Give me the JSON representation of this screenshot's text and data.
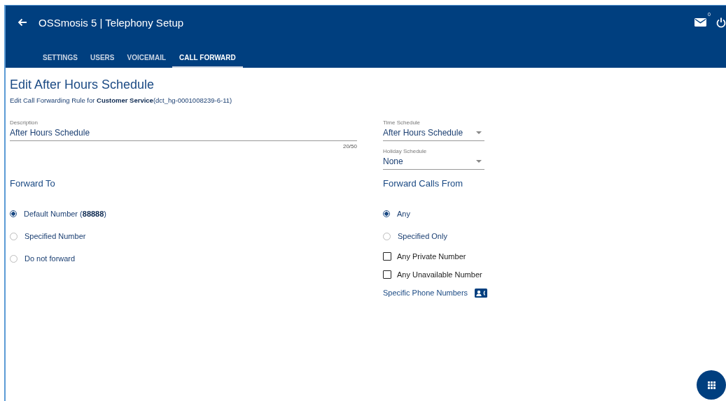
{
  "header": {
    "title": "OSSmosis 5 | Telephony Setup",
    "mail_count": "0"
  },
  "tabs": [
    {
      "label": "SETTINGS",
      "selected": false
    },
    {
      "label": "USERS",
      "selected": false
    },
    {
      "label": "VOICEMAIL",
      "selected": false
    },
    {
      "label": "CALL FORWARD",
      "selected": true
    }
  ],
  "page": {
    "title": "Edit After Hours Schedule",
    "subtitle": "Edit Call Forwarding Rule for **Customer Service**(dct_hg-0001008239-6-11)"
  },
  "description": {
    "label": "Description",
    "value": "After Hours Schedule",
    "counter": "20/50"
  },
  "schedules": [
    {
      "label": "Time Schedule",
      "value": "After Hours Schedule"
    },
    {
      "label": "Holiday Schedule",
      "value": "None"
    }
  ],
  "forward_to": {
    "heading": "Forward To",
    "options": [
      {
        "label": "Default Number (**88888**)",
        "selected": true
      },
      {
        "label": "Specified Number",
        "selected": false
      },
      {
        "label": "Do not forward",
        "selected": false
      }
    ]
  },
  "forward_calls_from": {
    "heading": "Forward Calls From",
    "options": [
      {
        "label": "Any",
        "selected": true
      },
      {
        "label": "Specified Only",
        "selected": false
      }
    ],
    "checkboxes": [
      {
        "label": "Any Private Number",
        "checked": false
      },
      {
        "label": "Any Unavailable Number",
        "checked": false
      }
    ],
    "link": "Specific Phone Numbers"
  }
}
